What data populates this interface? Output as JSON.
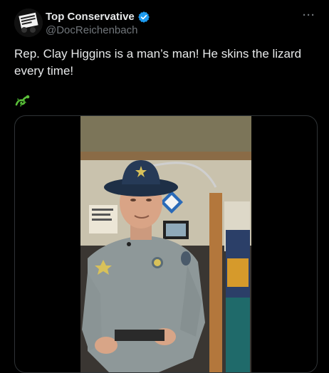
{
  "tweet": {
    "author": {
      "name": "Top Conservative",
      "handle": "@DocReichenbach",
      "verified": true,
      "verified_color": "#1d9bf0"
    },
    "more_label": "···",
    "text": "Rep. Clay Higgins is a man’s man! He skins the lizard every time!",
    "emoji": "lizard-emoji",
    "media": {
      "type": "video"
    }
  },
  "colors": {
    "background": "#000000",
    "text_primary": "#e7e9ea",
    "text_secondary": "#71767b",
    "border": "#2f3336"
  }
}
